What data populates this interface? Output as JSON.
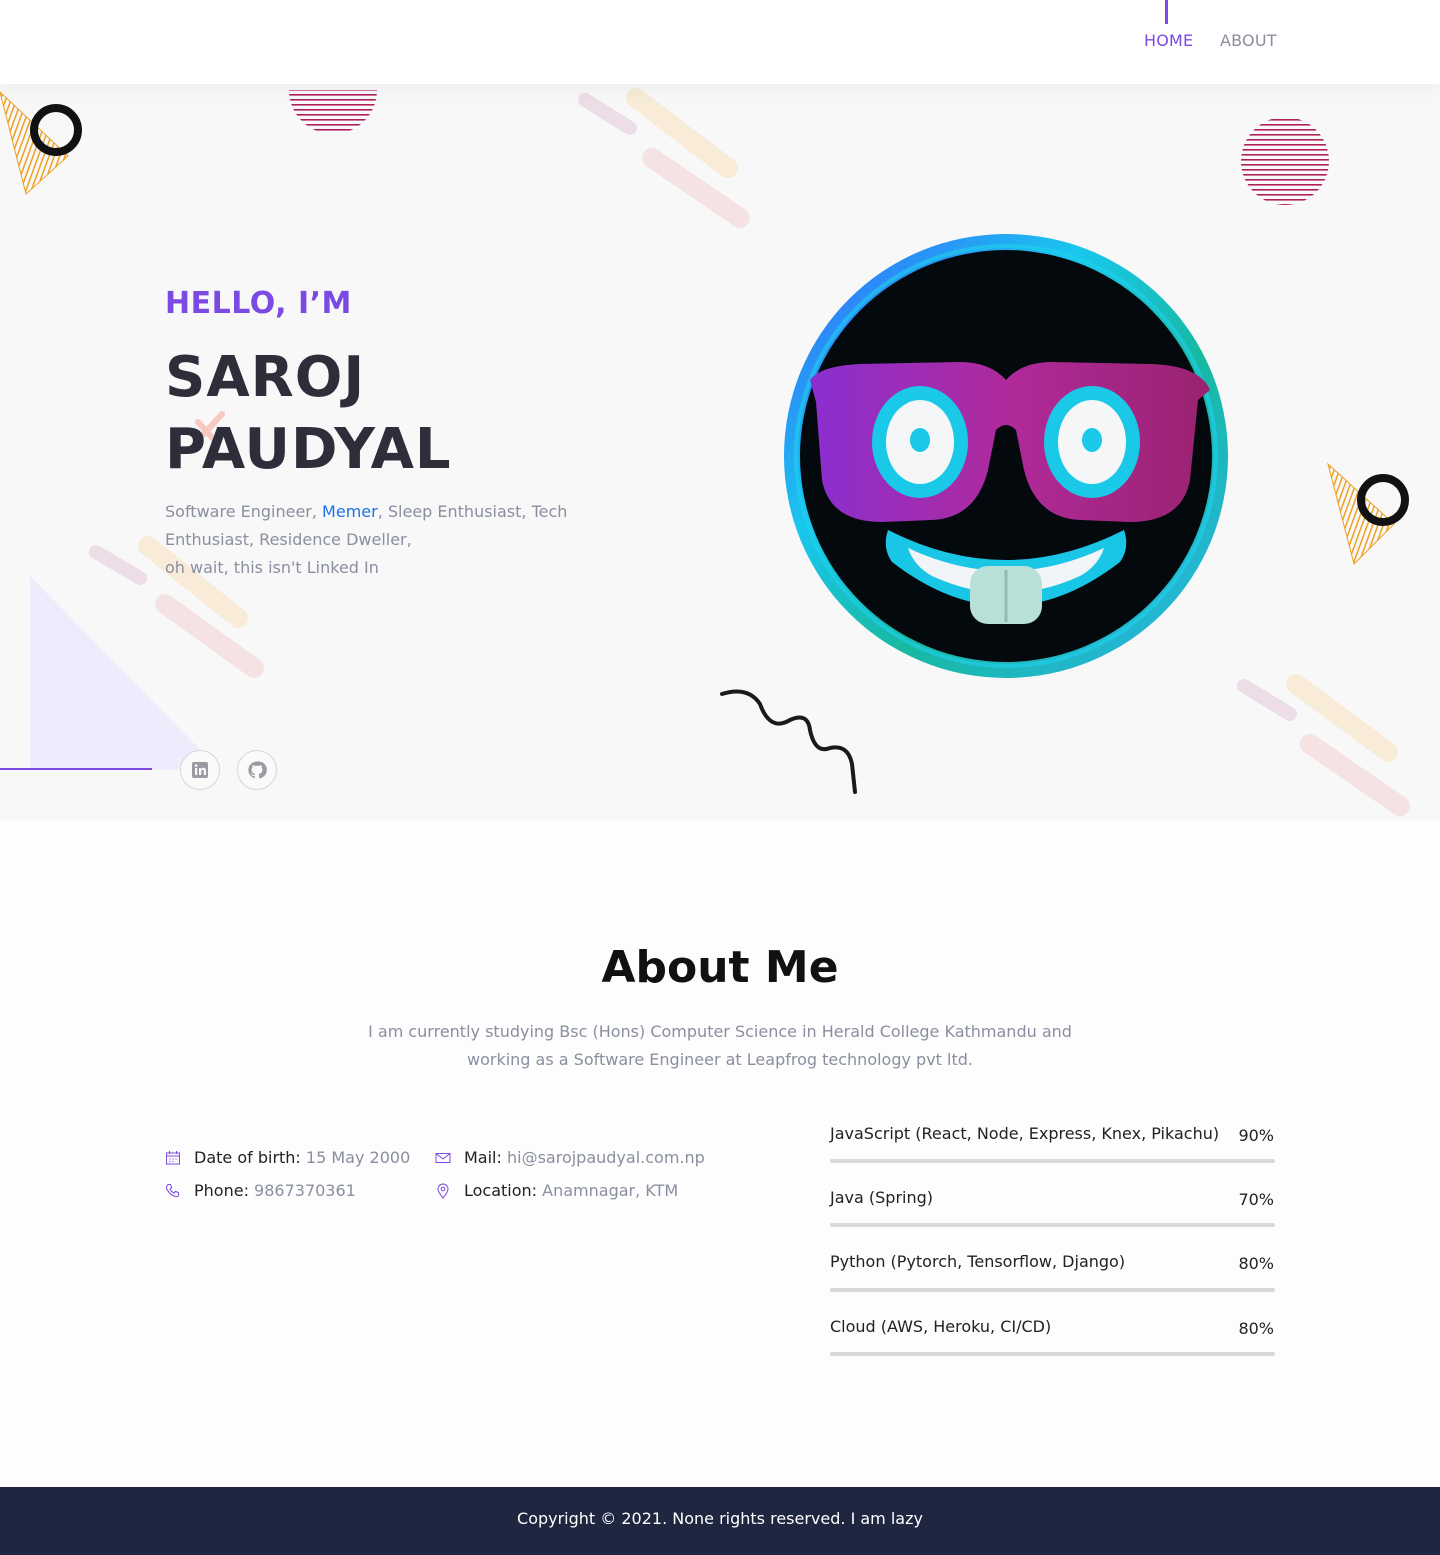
{
  "nav": {
    "items": [
      {
        "label": "HOME",
        "active": true
      },
      {
        "label": "ABOUT",
        "active": false
      }
    ],
    "accent": "#7b4ae2"
  },
  "hero": {
    "greeting": "HELLO, I’M",
    "name_line1": "SAROJ",
    "name_line2": "PAUDYAL",
    "tagline_before": "Software Engineer, ",
    "tagline_highlight": "Memer",
    "tagline_after": ", Sleep Enthusiast, Tech Enthusiast, Residence Dweller,",
    "tagline_line3": "oh wait, this isn't Linked In",
    "avatar_icon": "nerd-face-emoji-icon",
    "social": [
      {
        "name": "linkedin",
        "icon": "linkedin-icon"
      },
      {
        "name": "github",
        "icon": "github-icon"
      }
    ]
  },
  "about": {
    "title": "About Me",
    "text": "I am currently studying Bsc (Hons) Computer Science in Herald College Kathmandu and working as a Software Engineer at Leapfrog technology pvt ltd.",
    "info": {
      "dob_label": "Date of birth:",
      "dob_value": "15 May 2000",
      "phone_label": "Phone:",
      "phone_value": "9867370361",
      "mail_label": "Mail:",
      "mail_value": "hi@sarojpaudyal.com.np",
      "location_label": "Location:",
      "location_value": "Anamnagar, KTM"
    },
    "skills": [
      {
        "name": "JavaScript (React, Node, Express, Knex, Pikachu)",
        "percent_label": "90%",
        "level": 0.9
      },
      {
        "name": "Java (Spring)",
        "percent_label": "70%",
        "level": 0.7
      },
      {
        "name": "Python (Pytorch, Tensorflow, Django)",
        "percent_label": "80%",
        "level": 0.8
      },
      {
        "name": "Cloud (AWS, Heroku, CI/CD)",
        "percent_label": "80%",
        "level": 0.8
      }
    ]
  },
  "footer": {
    "copyright": "Copyright © 2021. None rights reserved. I am lazy"
  }
}
